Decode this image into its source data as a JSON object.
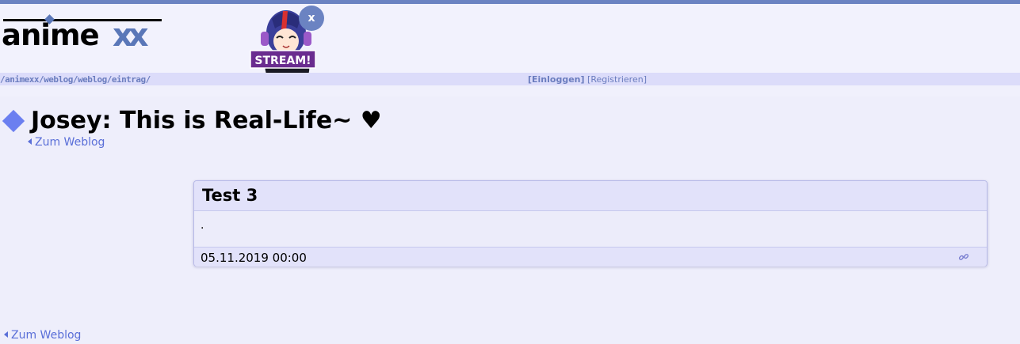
{
  "header": {
    "logo_text": "anime",
    "logo_accent": "xx",
    "mascot_badge": "STREAM!",
    "close_label": "x",
    "breadcrumb": "/animexx/weblog/weblog/eintrag/",
    "login_label": "[Einloggen]",
    "register_label": "[Registrieren]",
    "accent_color": "#6b83c2"
  },
  "page": {
    "author": "Josey",
    "blog_title": ": This is Real-Life~ ♥",
    "back_label": "Zum Weblog"
  },
  "entry": {
    "title": "Test 3",
    "body": ".",
    "date": "05.11.2019 00:00"
  },
  "icons": [
    "diamond-icon",
    "caret-left-icon",
    "link-icon",
    "close-icon"
  ]
}
